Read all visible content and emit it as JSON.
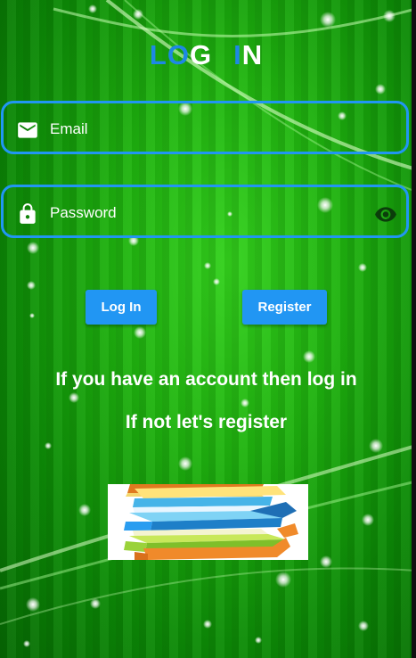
{
  "title": {
    "part1": "LO",
    "part2": "G",
    "part3": "I",
    "part4": "N"
  },
  "email": {
    "label": "Email",
    "icon": "mail-icon"
  },
  "password": {
    "label": "Password",
    "icon": "lock-icon",
    "toggle_icon": "eye-icon"
  },
  "buttons": {
    "login": "Log In",
    "register": "Register"
  },
  "messages": {
    "line1": "If you have an account then log in",
    "line2": "If not let's register"
  },
  "image": {
    "name": "books-image"
  },
  "colors": {
    "accent": "#2196f3",
    "background": "#1fb30f"
  }
}
